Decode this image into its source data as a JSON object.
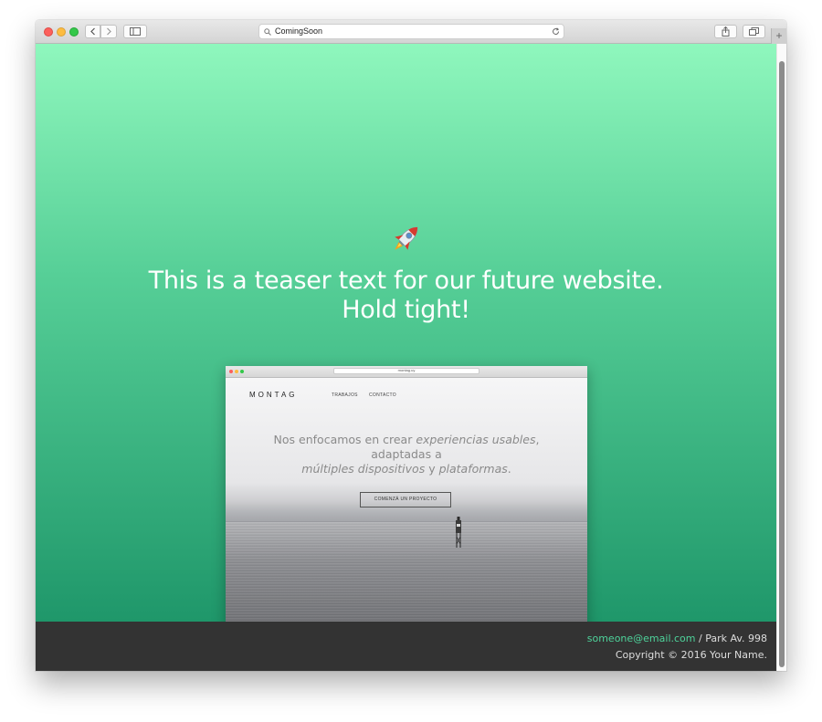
{
  "browser": {
    "address_text": "ComingSoon",
    "icons": {
      "back": "chevron-left-icon",
      "forward": "chevron-right-icon",
      "sidebar": "sidebar-icon",
      "search": "magnifier-icon",
      "reload": "reload-icon",
      "share": "share-icon",
      "tabs": "tabs-icon",
      "new_tab": "plus-icon"
    },
    "new_tab_label": "+"
  },
  "hero": {
    "icon": "rocket-icon",
    "teaser_line1": "This is a teaser text for our future website.",
    "teaser_line2": "Hold tight!"
  },
  "preview": {
    "address_text": "montag.uy",
    "logo": "MONTAG",
    "nav": [
      "TRABAJOS",
      "CONTACTO"
    ],
    "headline_part1": "Nos enfocamos en crear ",
    "headline_italic1": "experiencias usables",
    "headline_part2": ", adaptadas a",
    "headline_italic2": "múltiples dispositivos",
    "headline_part3": " y ",
    "headline_italic3": "plataformas",
    "headline_part4": ".",
    "cta_label": "COMENZÁ UN PROYECTO"
  },
  "footer": {
    "email": "someone@email.com",
    "address": " / Park Av. 998",
    "copyright": "Copyright © 2016 Your Name."
  },
  "colors": {
    "gradient_top": "#8ff7bd",
    "gradient_bottom": "#1f976a",
    "footer_bg": "#333333",
    "footer_link": "#4ed39b"
  }
}
